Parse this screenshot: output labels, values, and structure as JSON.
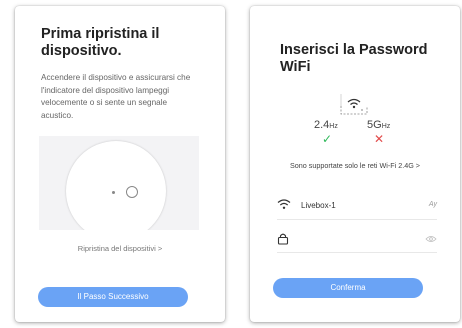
{
  "left": {
    "title": "Prima ripristina il dispositivo.",
    "description": "Accendere il dispositivo e assicurarsi che l'indicatore del dispositivo lampeggi velocemente o si sente un segnale acustico.",
    "reset_link": "Ripristina del dispositivi >",
    "next_button": "Il Passo Successivo"
  },
  "right": {
    "title": "Inserisci la Password WiFi",
    "band_24": "2.4",
    "band_5": "5G",
    "band_unit": "Hz",
    "supported_text": "Sono supportate solo le reti Wi-Fi 2.4G >",
    "ssid_value": "Livebox-1",
    "ssid_action": "Ay",
    "confirm_button": "Conferma"
  },
  "colors": {
    "accent": "#6aa3f5",
    "check": "#2fb95a",
    "cross": "#e24b4b"
  }
}
